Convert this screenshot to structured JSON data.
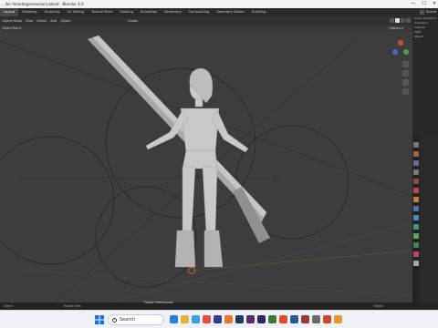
{
  "window": {
    "title": "...ller female\\generosion\\.blend - Blender 4.0",
    "min": "—",
    "max": "☐",
    "close": "✕"
  },
  "workspace_tabs": [
    {
      "label": "Layout",
      "active": true
    },
    {
      "label": "Modeling"
    },
    {
      "label": "Sculpting"
    },
    {
      "label": "UV Editing"
    },
    {
      "label": "Texture Paint"
    },
    {
      "label": "Shading"
    },
    {
      "label": "Animation"
    },
    {
      "label": "Rendering"
    },
    {
      "label": "Compositing"
    },
    {
      "label": "Geometry Nodes"
    },
    {
      "label": "Scripting"
    }
  ],
  "topbar": {
    "scene": "Scene"
  },
  "header": {
    "mode": "Object Mode",
    "menus": [
      "View",
      "Select",
      "Add",
      "Object"
    ],
    "orientation": "Global",
    "snap": "Options"
  },
  "subheader": {
    "left": "Object Box ▾",
    "right": "Options ▾"
  },
  "outliner": {
    "rows": [
      "Scene Collection",
      "Collection",
      "Camera",
      "Light",
      "Object"
    ]
  },
  "status": {
    "left": "Select",
    "mid": "Rotate View",
    "right": "Object",
    "popup": "Follow Preferences"
  },
  "taskbar": {
    "search_placeholder": "Search",
    "time": "",
    "date": ""
  },
  "colors": {
    "viewport_bg": "#3d3d3d",
    "accent": "#4772b3",
    "active_tab": "#474747"
  }
}
